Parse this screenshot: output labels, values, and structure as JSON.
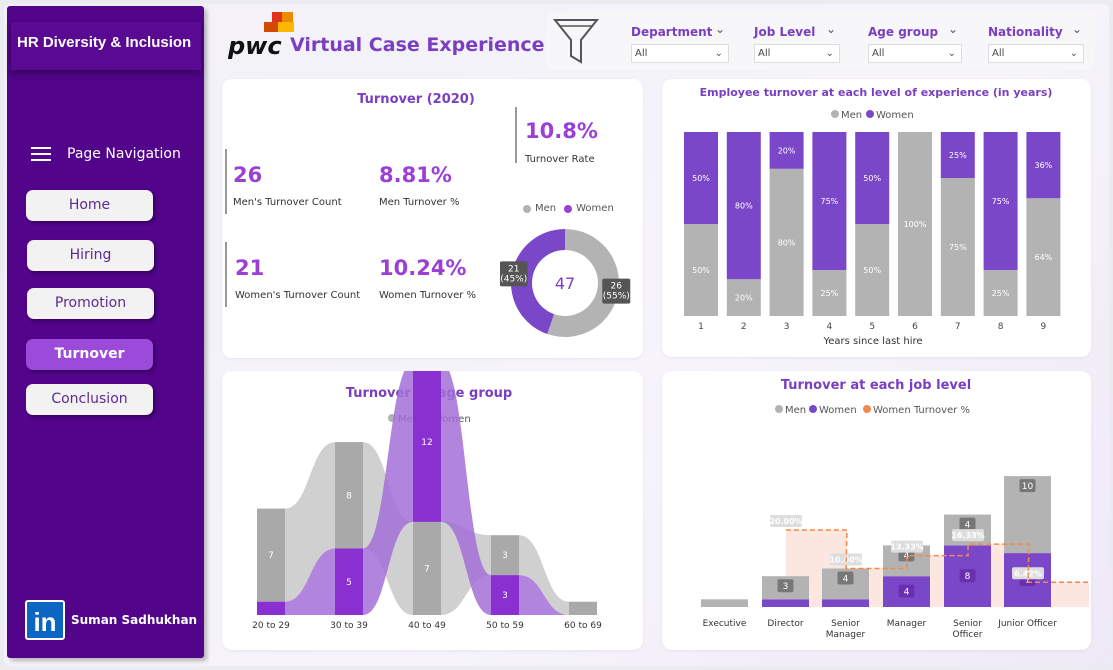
{
  "sidebar": {
    "brand": "HR Diversity & Inclusion",
    "nav_title": "Page Navigation",
    "buttons": [
      "Home",
      "Hiring",
      "Promotion",
      "Turnover",
      "Conclusion"
    ],
    "active": "Turnover",
    "author": "Suman Sadhukhan",
    "linkedin_icon": "in"
  },
  "header": {
    "logo_text": "pwc",
    "title": "Virtual Case Experience",
    "filter_icon": "funnel-icon"
  },
  "filters": [
    {
      "label": "Department",
      "value": "All"
    },
    {
      "label": "Job Level",
      "value": "All"
    },
    {
      "label": "Age group",
      "value": "All"
    },
    {
      "label": "Nationality",
      "value": "All"
    }
  ],
  "colors": {
    "men": "#b3b3b3",
    "women": "#7b47c9",
    "women_turnover": "#f08a4b",
    "accent": "#9b3fd5"
  },
  "turnover_card": {
    "title": "Turnover (2020)",
    "rate_value": "10.8%",
    "rate_label": "Turnover Rate",
    "men_count": "26",
    "men_count_label": "Men's Turnover Count",
    "men_pct": "8.81%",
    "men_pct_label": "Men Turnover %",
    "women_count": "21",
    "women_count_label": "Women's Turnover Count",
    "women_pct": "10.24%",
    "women_pct_label": "Women Turnover %",
    "legend": [
      "Men",
      "Women"
    ]
  },
  "chart_data": [
    {
      "type": "pie",
      "donut": true,
      "center_label": "47",
      "slices": [
        {
          "name": "Women",
          "value": 21,
          "label": "21\n(45%)"
        },
        {
          "name": "Men",
          "value": 26,
          "label": "26\n(55%)"
        }
      ]
    },
    {
      "type": "bar",
      "stacked": "100%",
      "title": "Employee turnover at each level of experience (in years)",
      "xlabel": "Years since last hire",
      "categories": [
        "1",
        "2",
        "3",
        "4",
        "5",
        "6",
        "7",
        "8",
        "9"
      ],
      "series": [
        {
          "name": "Men",
          "values": [
            50,
            20,
            80,
            25,
            50,
            100,
            75,
            25,
            64
          ],
          "labels": [
            "50%",
            "20%",
            "80%",
            "25%",
            "50%",
            "100%",
            "75%",
            "25%",
            "64%"
          ]
        },
        {
          "name": "Women",
          "values": [
            50,
            80,
            20,
            75,
            50,
            0,
            25,
            75,
            36
          ],
          "labels": [
            "50%",
            "80%",
            "20%",
            "75%",
            "50%",
            "",
            "25%",
            "75%",
            "36%"
          ]
        }
      ],
      "legend": "top"
    },
    {
      "type": "bar",
      "stacked": true,
      "ribbon": true,
      "title": "Turnover by age group",
      "categories": [
        "20 to 29",
        "30 to 39",
        "40 to 49",
        "50 to 59",
        "60 to 69"
      ],
      "series": [
        {
          "name": "Men",
          "values": [
            7,
            8,
            7,
            3,
            1
          ]
        },
        {
          "name": "Women",
          "values": [
            1,
            5,
            12,
            3,
            0
          ]
        }
      ],
      "legend": "top"
    },
    {
      "type": "bar",
      "stacked": true,
      "title": "Turnover at each job level",
      "categories": [
        "Executive",
        "Director",
        "Senior\nManager",
        "Manager",
        "Senior\nOfficer",
        "Junior Officer"
      ],
      "series": [
        {
          "name": "Men",
          "values": [
            1,
            3,
            4,
            4,
            4,
            10
          ]
        },
        {
          "name": "Women",
          "values": [
            0,
            1,
            1,
            4,
            8,
            7
          ]
        },
        {
          "name": "Women Turnover %",
          "values": [
            0,
            20.0,
            10.0,
            13.33,
            16.33,
            6.42
          ],
          "labels": [
            "",
            "20.00%",
            "10.00%",
            "13.33%",
            "16.33%",
            "6.42%"
          ]
        }
      ],
      "legend": "top"
    }
  ]
}
